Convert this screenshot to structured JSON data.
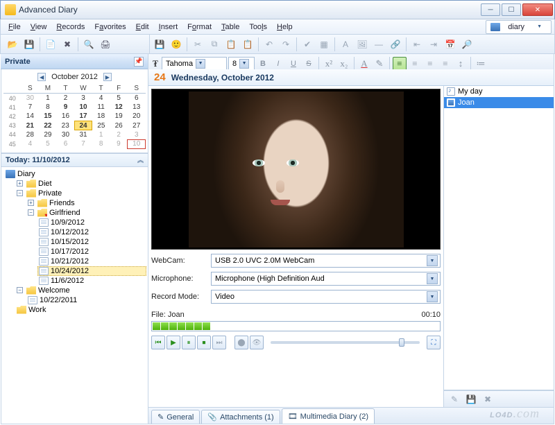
{
  "window": {
    "title": "Advanced Diary"
  },
  "menu": {
    "file": "File",
    "view": "View",
    "records": "Records",
    "favorites": "Favorites",
    "edit": "Edit",
    "insert": "Insert",
    "format": "Format",
    "table": "Table",
    "tools": "Tools",
    "help": "Help",
    "diary_combo": "diary"
  },
  "sidebar": {
    "header": "Private"
  },
  "calendar": {
    "month": "October 2012",
    "days": [
      "S",
      "M",
      "T",
      "W",
      "T",
      "F",
      "S"
    ],
    "weeks": [
      {
        "wk": "40",
        "d": [
          "30",
          "1",
          "2",
          "3",
          "4",
          "5",
          "6"
        ],
        "dim": [
          0
        ]
      },
      {
        "wk": "41",
        "d": [
          "7",
          "8",
          "9",
          "10",
          "11",
          "12",
          "13"
        ],
        "bold": [
          2,
          3,
          5
        ]
      },
      {
        "wk": "42",
        "d": [
          "14",
          "15",
          "16",
          "17",
          "18",
          "19",
          "20"
        ],
        "bold": [
          1,
          3
        ]
      },
      {
        "wk": "43",
        "d": [
          "21",
          "22",
          "23",
          "24",
          "25",
          "26",
          "27"
        ],
        "bold": [
          0,
          1,
          3
        ],
        "sel": 3
      },
      {
        "wk": "44",
        "d": [
          "28",
          "29",
          "30",
          "31",
          "1",
          "2",
          "3"
        ],
        "dim": [
          4,
          5,
          6
        ]
      },
      {
        "wk": "45",
        "d": [
          "4",
          "5",
          "6",
          "7",
          "8",
          "9",
          "10"
        ],
        "dim": [
          0,
          1,
          2,
          3,
          4,
          5,
          6
        ],
        "today": 6
      }
    ]
  },
  "today": {
    "label": "Today: 11/10/2012"
  },
  "tree": {
    "root": "Diary",
    "nodes": {
      "diet": "Diet",
      "private": "Private",
      "friends": "Friends",
      "girlfriend": "Girlfriend",
      "d1": "10/9/2012",
      "d2": "10/12/2012",
      "d3": "10/15/2012",
      "d4": "10/17/2012",
      "d5": "10/21/2012",
      "d6": "10/24/2012",
      "d7": "11/6/2012",
      "welcome": "Welcome",
      "w1": "10/22/2011",
      "work": "Work"
    }
  },
  "entry": {
    "daynum": "24",
    "daytext": "Wednesday, October 2012"
  },
  "format": {
    "font": "Tahoma",
    "size": "8"
  },
  "form": {
    "webcam_label": "WebCam:",
    "webcam_value": "USB 2.0 UVC 2.0M WebCam",
    "mic_label": "Microphone:",
    "mic_value": "Microphone (High Definition Aud",
    "mode_label": "Record Mode:",
    "mode_value": "Video",
    "file_label": "File: Joan",
    "duration": "00:10"
  },
  "entries": {
    "e1": "My day",
    "e2": "Joan"
  },
  "tabs": {
    "general": "General",
    "attachments": "Attachments (1)",
    "multimedia": "Multimedia Diary (2)"
  },
  "watermark": "LO4D.com"
}
